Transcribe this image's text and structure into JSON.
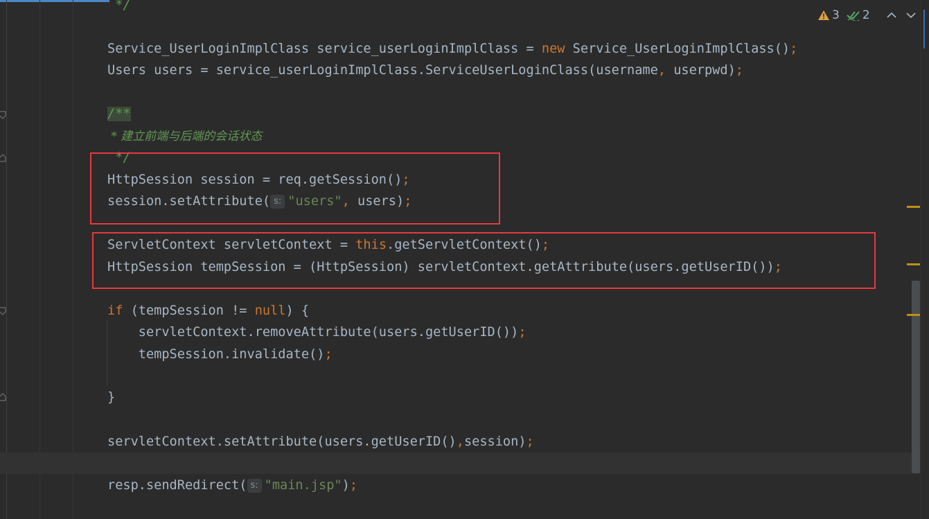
{
  "inspections": {
    "warnings_count": "3",
    "weak_warnings_count": "2"
  },
  "colors": {
    "background": "#2b2b2b",
    "keyword": "#cc7832",
    "string": "#6a8759",
    "comment": "#629755",
    "text": "#a9b7c6",
    "highlight_box": "#e8393f",
    "warning_marker": "#be9117"
  },
  "icons": [
    "warning-icon",
    "double-check-icon",
    "chevron-up-icon",
    "chevron-down-icon"
  ],
  "code": {
    "l0_comment_end": " */",
    "l1_a": "Service_UserLoginImplClass service_userLoginImplClass = ",
    "l1_new": "new",
    "l1_b": " Service_UserLoginImplClass()",
    "l1_semi": ";",
    "l2_a": "Users users = service_userLoginImplClass.ServiceUserLoginClass(username",
    "l2_comma": ",",
    "l2_b": " userpwd)",
    "l2_semi": ";",
    "l3_doc_start": "/**",
    "l4_doc_text": " * 建立前端与后端的会话状态",
    "l5_doc_end": " */",
    "l6_a": "HttpSession session = req.getSession()",
    "l6_semi": ";",
    "l7_a": "session.setAttribute(",
    "l7_hint": "s:",
    "l7_str": "\"users\"",
    "l7_comma": ",",
    "l7_b": " users)",
    "l7_semi": ";",
    "l8_a": "ServletContext servletContext = ",
    "l8_this": "this",
    "l8_b": ".getServletContext()",
    "l8_semi": ";",
    "l9_a": "HttpSession tempSession = (HttpSession) servletContext.getAttribute(users.getUserID())",
    "l9_semi": ";",
    "l10_if": "if",
    "l10_a": " (tempSession != ",
    "l10_null": "null",
    "l10_b": ") {",
    "l11_a": "    servletContext.removeAttribute(users.getUserID())",
    "l11_semi": ";",
    "l12_a": "    tempSession.invalidate()",
    "l12_semi": ";",
    "l13_close": "}",
    "l14_a": "servletContext.setAttribute(users.getUserID()",
    "l14_comma": ",",
    "l14_b": "session)",
    "l14_semi": ";",
    "l15_a": "resp.sendRedirect(",
    "l15_hint": "s:",
    "l15_str": "\"main.jsp\"",
    "l15_b": ")",
    "l15_semi": ";"
  }
}
